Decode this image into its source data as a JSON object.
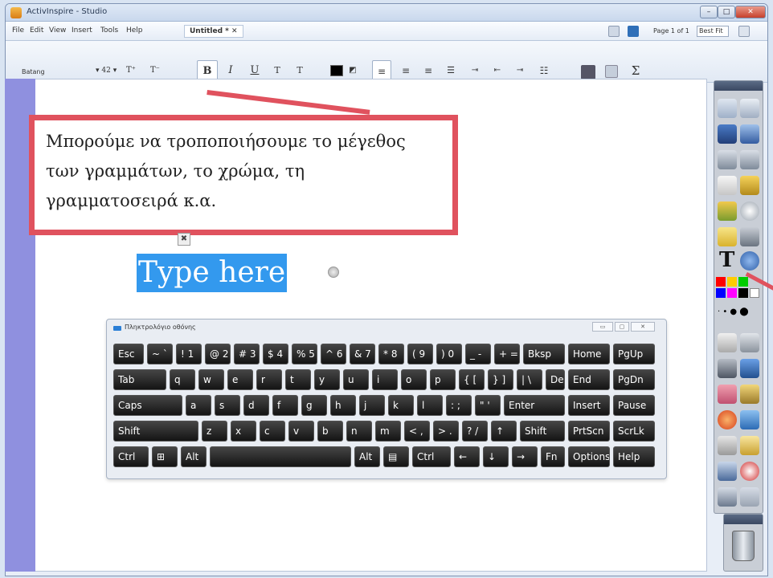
{
  "window": {
    "title": "ActivInspire - Studio"
  },
  "menu": {
    "items": [
      "File",
      "Edit",
      "View",
      "Insert",
      "Tools",
      "Help"
    ],
    "document_tab": "Untitled * ✕",
    "page_indicator": "Page 1 of 1",
    "zoom": "Best Fit"
  },
  "format": {
    "font": "Batang",
    "bold": "B",
    "italic": "I",
    "underline": "U",
    "superscript": "T",
    "subscript": "T",
    "sigma": "Σ",
    "text_color": "#000000"
  },
  "callout": {
    "text": "Μπορούμε να τροποποιήσουμε το μέγεθος των γραμμάτων, το χρώμα, τη γραμματοσειρά κ.α."
  },
  "textbox": {
    "text": "Type here",
    "move_handle": "✖"
  },
  "keyboard": {
    "title": "Πληκτρολόγιο οθόνης",
    "rows": [
      [
        "Esc",
        "~ `",
        "! 1",
        "@ 2",
        "# 3",
        "$ 4",
        "% 5",
        "^ 6",
        "& 7",
        "* 8",
        "( 9",
        ") 0",
        "_ -",
        "+ =",
        "Bksp",
        "Home",
        "PgUp"
      ],
      [
        "Tab",
        "q",
        "w",
        "e",
        "r",
        "t",
        "y",
        "u",
        "i",
        "o",
        "p",
        "{ [",
        "} ]",
        "| \\",
        "Del",
        "End",
        "PgDn"
      ],
      [
        "Caps",
        "a",
        "s",
        "d",
        "f",
        "g",
        "h",
        "j",
        "k",
        "l",
        ": ;",
        "\" '",
        "Enter",
        "Insert",
        "Pause"
      ],
      [
        "Shift",
        "z",
        "x",
        "c",
        "v",
        "b",
        "n",
        "m",
        "< ,",
        "> .",
        "? /",
        "↑",
        "Shift",
        "PrtScn",
        "ScrLk"
      ],
      [
        "Ctrl",
        "⊞",
        "Alt",
        "",
        "Alt",
        "▤",
        "Ctrl",
        "←",
        "↓",
        "→",
        "Fn",
        "Options",
        "Help"
      ]
    ]
  },
  "toolbox": {
    "text_tool": "T"
  },
  "colors": {
    "accent_red": "#e0525e",
    "left_strip": "#8f90df",
    "selection": "#3399ee",
    "palette": [
      "#ff0000",
      "#ffcc00",
      "#00cc00",
      "#0000ff",
      "#ff00ff",
      "#00ccff",
      "#ffffff",
      "#000000"
    ]
  }
}
